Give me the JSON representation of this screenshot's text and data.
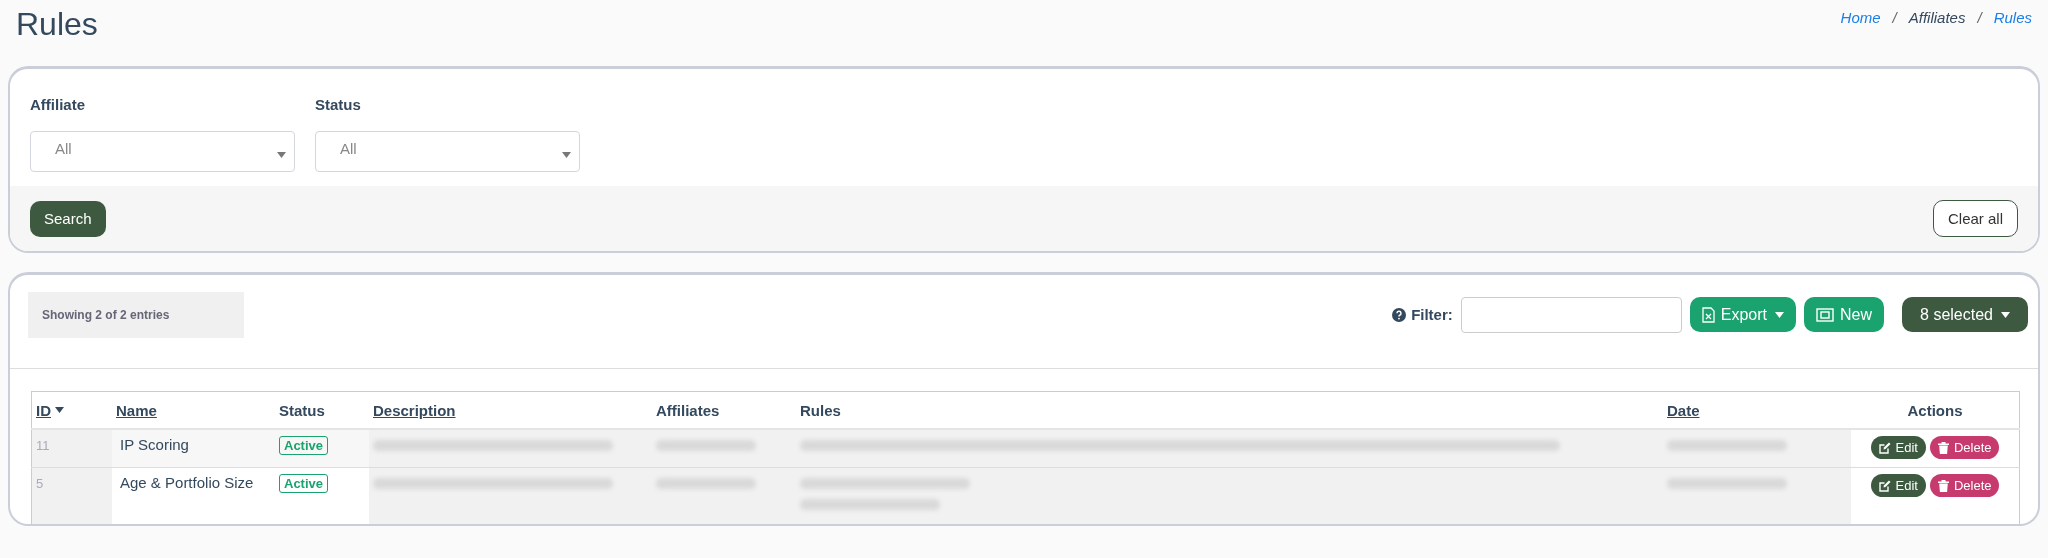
{
  "page": {
    "title": "Rules"
  },
  "breadcrumb": [
    {
      "label": "Home",
      "link": true
    },
    {
      "sep": "/",
      "label": "Affiliates",
      "link": false
    },
    {
      "sep": "/",
      "label": "Rules",
      "link": true
    }
  ],
  "filters": [
    {
      "label": "Affiliate",
      "placeholder": "All"
    },
    {
      "label": "Status",
      "placeholder": "All"
    }
  ],
  "filter_actions": {
    "search": "Search",
    "clear": "Clear all"
  },
  "toolbar": {
    "entries_info": "Showing 2 of 2 entries",
    "filter_label": "Filter:",
    "export": "Export",
    "new": "New",
    "selected": "8 selected"
  },
  "table": {
    "columns": [
      {
        "label": "ID",
        "sortable": true,
        "sorted": true
      },
      {
        "label": "Name",
        "sortable": true,
        "sorted": false
      },
      {
        "label": "Status",
        "sortable": false,
        "sorted": false
      },
      {
        "label": "Description",
        "sortable": true,
        "sorted": false
      },
      {
        "label": "Affiliates",
        "sortable": false,
        "sorted": false
      },
      {
        "label": "Rules",
        "sortable": false,
        "sorted": false
      },
      {
        "label": "Date",
        "sortable": true,
        "sorted": false
      },
      {
        "label": "Actions",
        "sortable": false,
        "sorted": false
      }
    ],
    "rows": [
      {
        "id": "11",
        "name": "IP Scoring",
        "status": "Active",
        "edit": "Edit",
        "delete": "Delete"
      },
      {
        "id": "5",
        "name": "Age & Portfolio Size",
        "status": "Active",
        "edit": "Edit",
        "delete": "Delete"
      }
    ]
  }
}
